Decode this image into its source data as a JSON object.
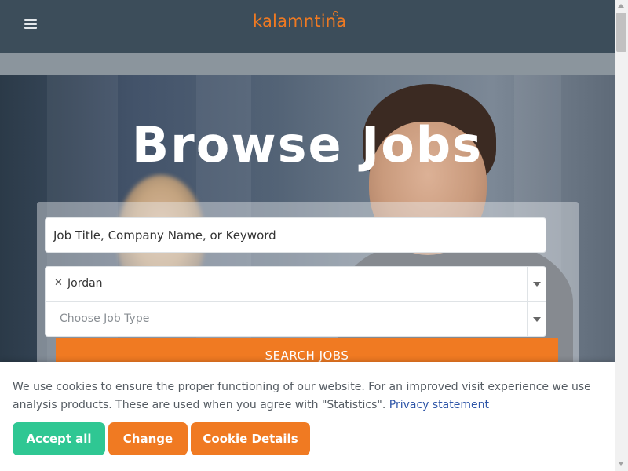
{
  "header": {
    "logo_text": "kalamntina",
    "menu_icon": "hamburger-menu-icon",
    "brand_color": "#f07a22"
  },
  "hero": {
    "title": "Browse Jobs"
  },
  "search": {
    "keyword_placeholder": "Job Title, Company Name, or Keyword",
    "location": {
      "selected": "Jordan",
      "remove_icon": "close-icon",
      "dropdown_icon": "chevron-down-icon"
    },
    "job_type": {
      "placeholder": "Choose Job Type",
      "dropdown_icon": "chevron-down-icon"
    },
    "button_label": "SEARCH JOBS"
  },
  "cookie_banner": {
    "message": "We use cookies to ensure the proper functioning of our website. For an improved visit experience we use analysis products. These are used when you agree with \"Statistics\".",
    "link_label": "Privacy statement",
    "accept_label": "Accept all",
    "change_label": "Change",
    "details_label": "Cookie Details",
    "accept_color": "#2fc793",
    "secondary_color": "#f07a22"
  }
}
